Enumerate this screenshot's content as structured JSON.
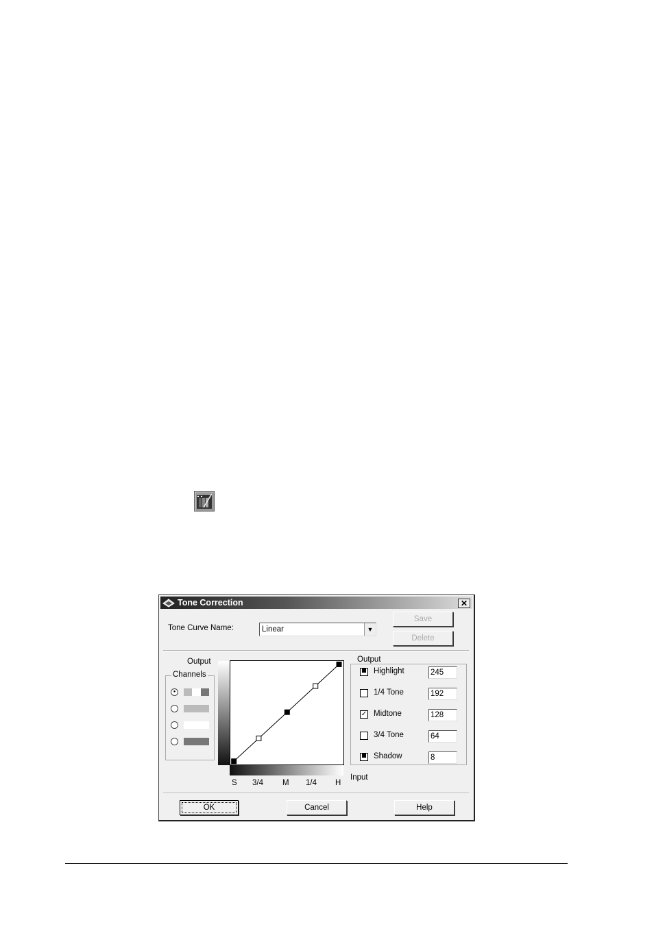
{
  "toolbar_icon": "tone-correction-icon",
  "dialog": {
    "title": "Tone Correction",
    "close_label": "✕",
    "tone_curve_label": "Tone Curve Name:",
    "tone_curve_value": "Linear",
    "save_label": "Save",
    "delete_label": "Delete",
    "output_axis_label": "Output",
    "input_axis_label": "Input",
    "channels_label": "Channels",
    "channels": [
      {
        "selected": true,
        "colors": [
          "#bbbbbb",
          "#ffffff",
          "#777777"
        ]
      },
      {
        "selected": false,
        "colors": [
          "#bbbbbb"
        ]
      },
      {
        "selected": false,
        "colors": [
          "#ffffff"
        ]
      },
      {
        "selected": false,
        "colors": [
          "#777777"
        ]
      }
    ],
    "input_ticks": [
      "S",
      "3/4",
      "M",
      "1/4",
      "H"
    ],
    "output_group_label": "Output",
    "output_rows": [
      {
        "label": "Highlight",
        "state": "filled",
        "value": "245"
      },
      {
        "label": "1/4 Tone",
        "state": "unchecked",
        "value": "192"
      },
      {
        "label": "Midtone",
        "state": "checked",
        "value": "128"
      },
      {
        "label": "3/4 Tone",
        "state": "unchecked",
        "value": "64"
      },
      {
        "label": "Shadow",
        "state": "filled",
        "value": "8"
      }
    ],
    "curve_points": [
      {
        "input": 8,
        "output": 8,
        "filled": true
      },
      {
        "input": 64,
        "output": 64,
        "filled": false
      },
      {
        "input": 128,
        "output": 128,
        "filled": true
      },
      {
        "input": 192,
        "output": 192,
        "filled": false
      },
      {
        "input": 245,
        "output": 245,
        "filled": true
      }
    ],
    "ok_label": "OK",
    "cancel_label": "Cancel",
    "help_label": "Help"
  }
}
